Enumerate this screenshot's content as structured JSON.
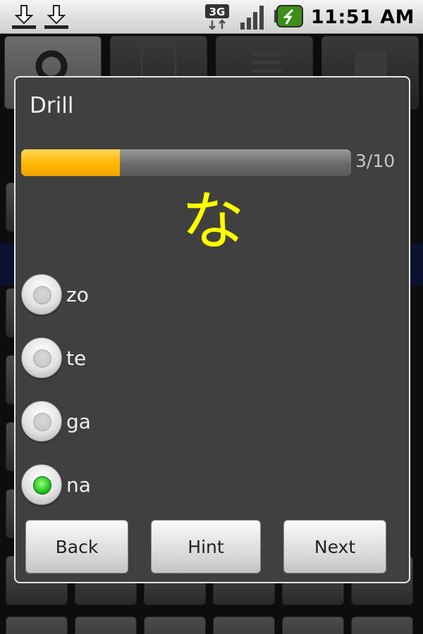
{
  "status_bar": {
    "time": "11:51 AM",
    "network_type": "3G",
    "icons": [
      "download-icon",
      "download-icon",
      "network-3g-icon",
      "signal-icon",
      "battery-charging-icon"
    ]
  },
  "background_app": {
    "tabs": [
      "search-icon",
      "kanji-icon",
      "list-icon",
      "list-detail-icon"
    ]
  },
  "dialog": {
    "title": "Drill",
    "progress": {
      "current": 3,
      "total": 10,
      "label": "3/10",
      "fraction": 0.3,
      "color": "#ffb600"
    },
    "character": "な",
    "character_color": "#ffff00",
    "options": [
      {
        "label": "zo",
        "checked": false
      },
      {
        "label": "te",
        "checked": false
      },
      {
        "label": "ga",
        "checked": false
      },
      {
        "label": "na",
        "checked": true
      }
    ],
    "buttons": {
      "back": "Back",
      "hint": "Hint",
      "next": "Next"
    }
  }
}
